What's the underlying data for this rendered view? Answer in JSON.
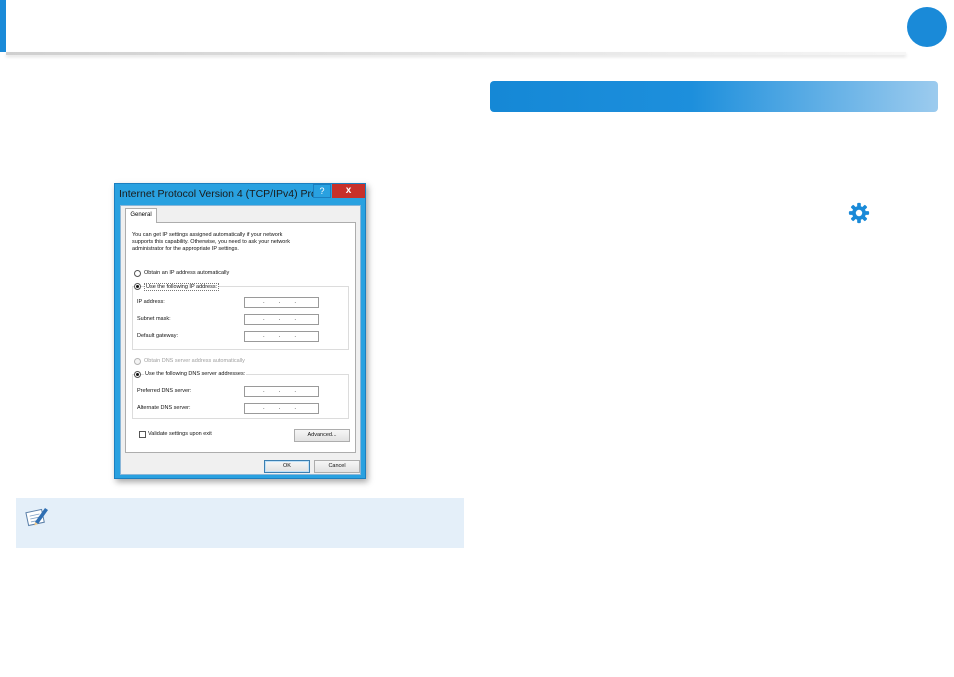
{
  "colors": {
    "accent": "#1a8ad8",
    "note_bg": "#e4eff9",
    "dialog_frame": "#29a1e0",
    "close_red": "#c7302a"
  },
  "dialog": {
    "title": "Internet Protocol Version 4 (TCP/IPv4) Pro...",
    "help_label": "?",
    "close_label": "x",
    "tab": "General",
    "intro_line1": "You can get IP settings assigned automatically if your network",
    "intro_line2": "supports this capability. Otherwise, you need to ask your network",
    "intro_line3": "administrator for the appropriate IP settings.",
    "obtain_ip": "Obtain an IP address automatically",
    "use_ip": "Use the following IP address:",
    "ip_address_label": "IP address:",
    "subnet_mask_label": "Subnet mask:",
    "default_gateway_label": "Default gateway:",
    "ip_value": "...",
    "obtain_dns": "Obtain DNS server address automatically",
    "use_dns": "Use the following DNS server addresses:",
    "preferred_dns_label": "Preferred DNS server:",
    "alternate_dns_label": "Alternate DNS server:",
    "validate_label": "Validate settings upon exit",
    "advanced_button": "Advanced...",
    "ok_button": "OK",
    "cancel_button": "Cancel"
  },
  "icons": {
    "settings": "gear-icon",
    "note": "note-pencil-icon"
  }
}
